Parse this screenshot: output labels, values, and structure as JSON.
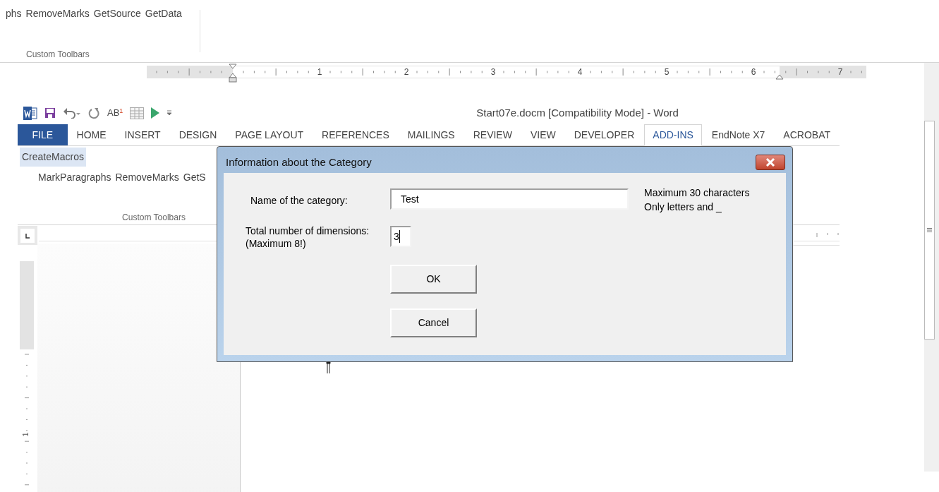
{
  "top_ribbon": {
    "commands": [
      "phs",
      "RemoveMarks",
      "GetSource",
      "GetData"
    ],
    "group_label": "Custom Toolbars"
  },
  "top_ruler": {
    "labels": [
      "1",
      "2",
      "3",
      "4",
      "5",
      "6",
      "7"
    ]
  },
  "quick_access": {
    "format_label": "AB$^{1}$"
  },
  "window": {
    "title": "Start07e.docm [Compatibility Mode] - Word"
  },
  "tabs": [
    {
      "label": "FILE",
      "kind": "file",
      "selected": false
    },
    {
      "label": "HOME",
      "kind": "tab",
      "selected": false
    },
    {
      "label": "INSERT",
      "kind": "tab",
      "selected": false
    },
    {
      "label": "DESIGN",
      "kind": "tab",
      "selected": false
    },
    {
      "label": "PAGE LAYOUT",
      "kind": "tab",
      "selected": false
    },
    {
      "label": "REFERENCES",
      "kind": "tab",
      "selected": false
    },
    {
      "label": "MAILINGS",
      "kind": "tab",
      "selected": false
    },
    {
      "label": "REVIEW",
      "kind": "tab",
      "selected": false
    },
    {
      "label": "VIEW",
      "kind": "tab",
      "selected": false
    },
    {
      "label": "DEVELOPER",
      "kind": "tab",
      "selected": false
    },
    {
      "label": "ADD-INS",
      "kind": "tab",
      "selected": true
    },
    {
      "label": "EndNote X7",
      "kind": "tab",
      "selected": false
    },
    {
      "label": "ACROBAT",
      "kind": "tab",
      "selected": false
    }
  ],
  "ribbon": {
    "menu": [
      {
        "label": "CreateMacros",
        "selected": true
      }
    ],
    "commands": [
      "MarkParagraphs",
      "RemoveMarks",
      "GetS"
    ],
    "group_label": "Custom Toolbars"
  },
  "vertical_ruler": {
    "labels": [
      "1"
    ]
  },
  "dialog": {
    "title": "Information about the Category",
    "name_field": {
      "label": "Name of the category:",
      "value": "Test"
    },
    "hints": [
      "Maximum 30 characters",
      "Only letters and _"
    ],
    "dimensions_field": {
      "label": "Total number of dimensions:",
      "note": "(Maximum 8!)",
      "value": "3"
    },
    "buttons": [
      "OK",
      "Cancel"
    ]
  }
}
